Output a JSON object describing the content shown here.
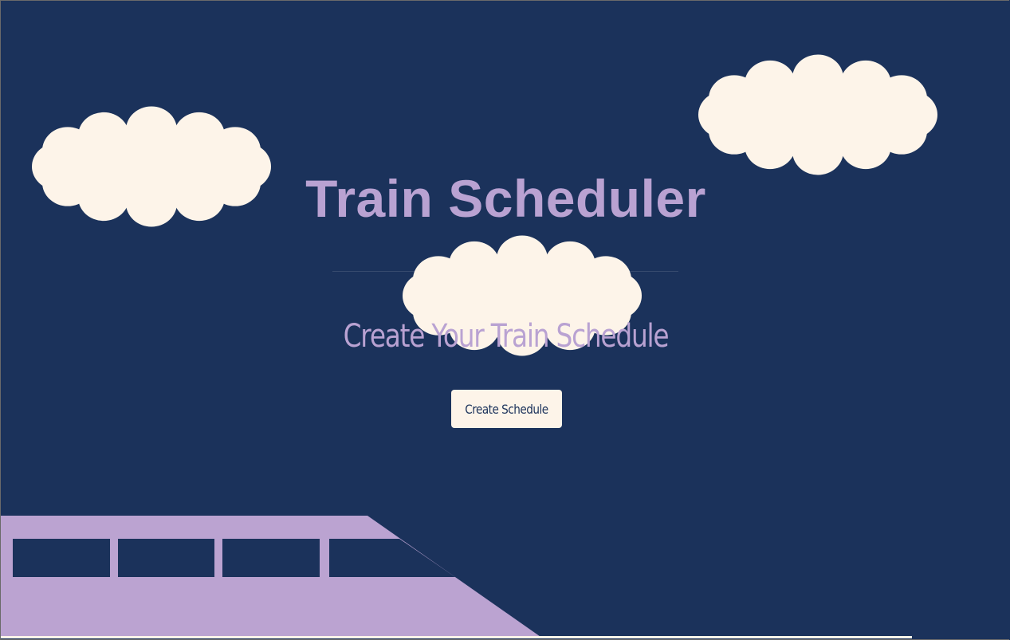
{
  "header": {
    "title": "Train Scheduler",
    "subtitle": "Create Your Train Schedule"
  },
  "actions": {
    "create_label": "Create Schedule"
  },
  "colors": {
    "background": "#1b325b",
    "accent": "#b9a2d2",
    "cloud": "#fdf4e9"
  },
  "decor": {
    "clouds": [
      "cloud-left",
      "cloud-right",
      "cloud-center"
    ],
    "train": "train-illustration"
  }
}
